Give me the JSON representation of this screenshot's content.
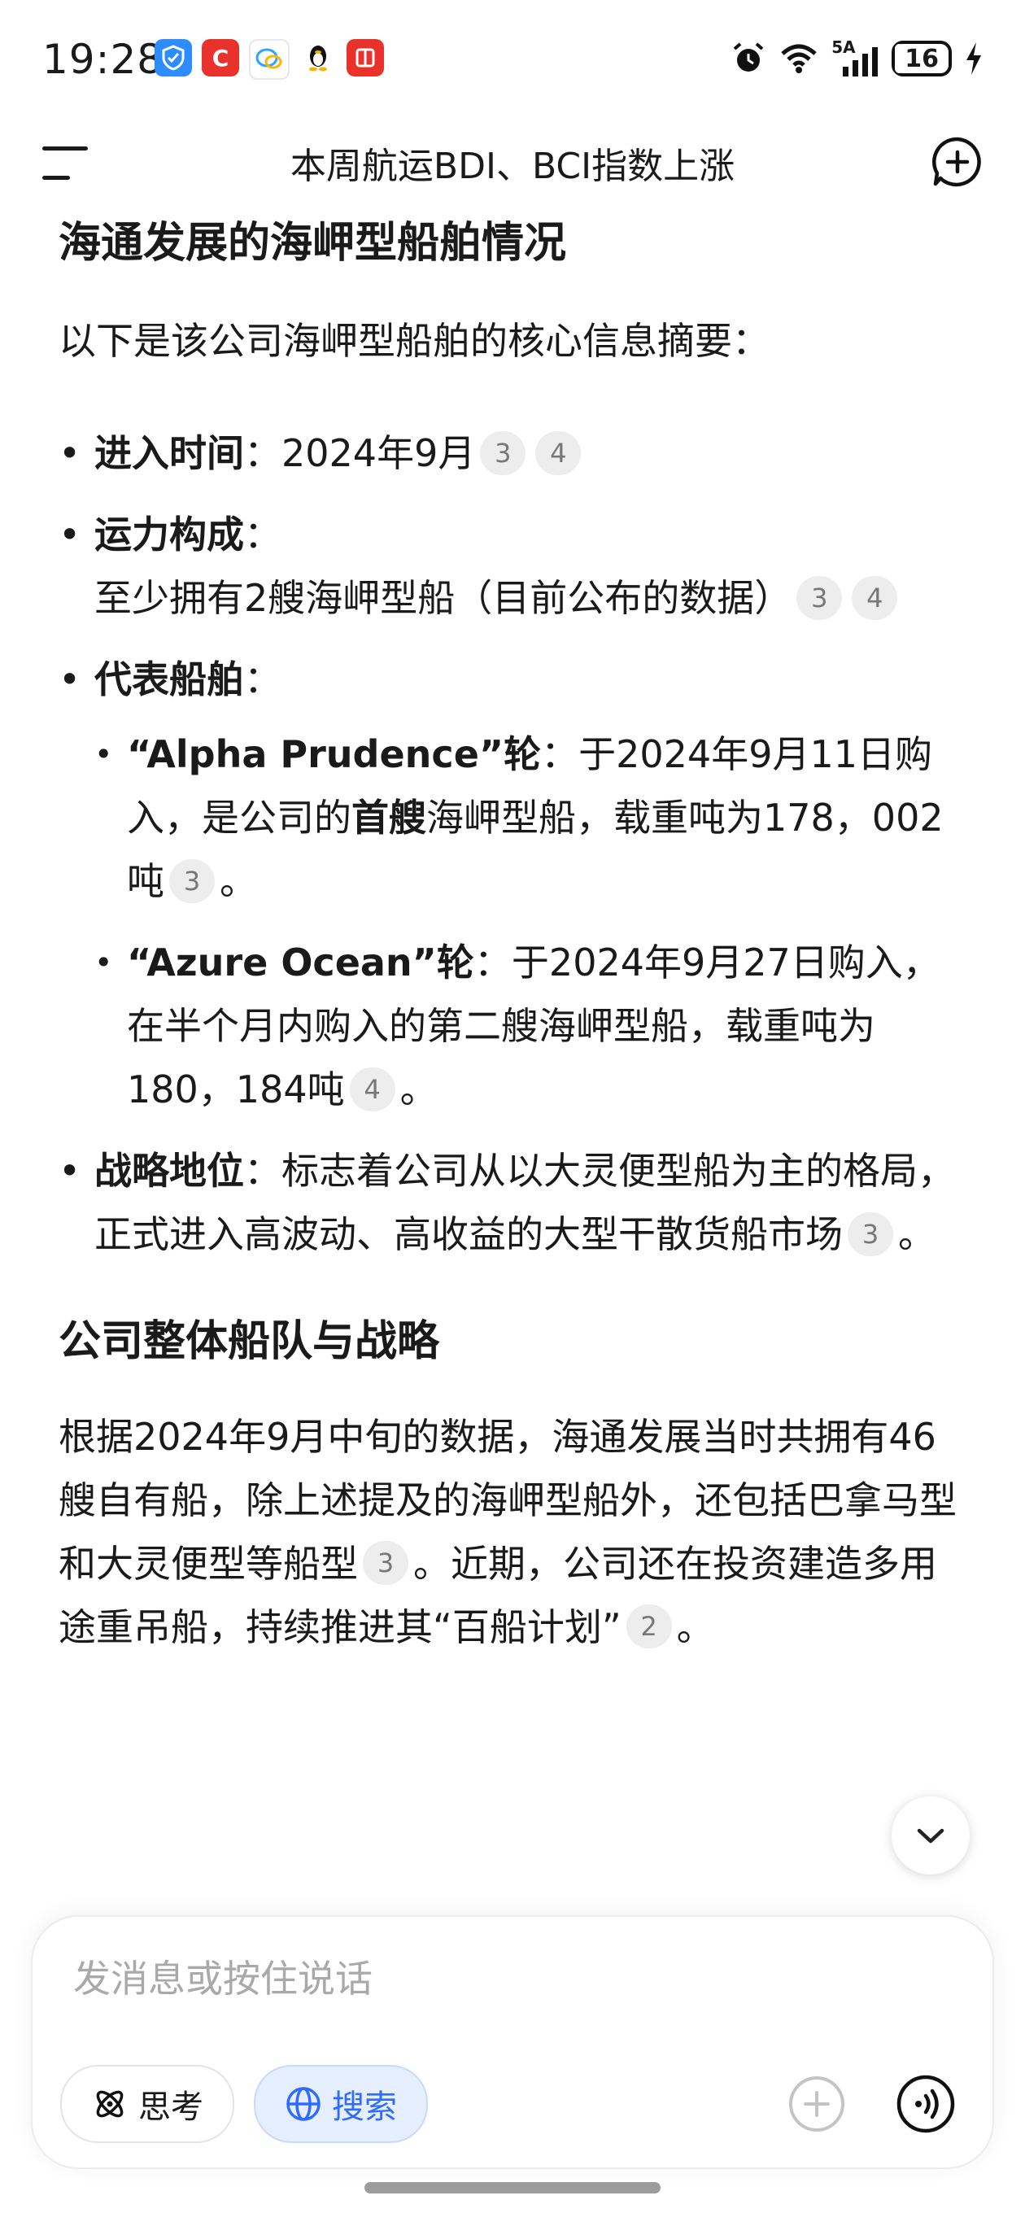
{
  "status_bar": {
    "time": "19:28",
    "notification_icons": [
      "shield-app-icon",
      "c-app-icon",
      "chat-bubble-icon",
      "penguin-icon",
      "red-app-icon"
    ],
    "system_icons": [
      "alarm-icon",
      "wifi-icon",
      "signal-5g-icon",
      "charging-icon"
    ],
    "network_label": "5A",
    "battery": "16",
    "battery_level": 0.16
  },
  "header": {
    "title": "本周航运BDI、BCI指数上涨"
  },
  "article": {
    "section1": {
      "heading": "海通发展的海岬型船舶情况",
      "intro": "以下是该公司海岬型船舶的核心信息摘要：",
      "items": [
        {
          "label": "进入时间",
          "sep": "：",
          "text": "2024年9月",
          "cites": [
            "3",
            "4"
          ]
        },
        {
          "label": "运力构成",
          "sep": "：",
          "text": "至少拥有2艘海岬型船（目前公布的数据）",
          "cites": [
            "3",
            "4"
          ]
        },
        {
          "label": "代表船舶",
          "sep": "："
        }
      ],
      "ships": [
        {
          "name": "“Alpha Prudence”轮",
          "sep": "：",
          "text1": "于2024年9月11日购入，是公司的",
          "emph": "首艘",
          "text2": "海岬型船，载重吨为178，002吨",
          "cite": "3",
          "end": "。"
        },
        {
          "name": "“Azure Ocean”轮",
          "sep": "：",
          "text1": "于2024年9月27日购入，在半个月内购入的第二艘海岬型船，载重吨为180，184吨",
          "cite": "4",
          "end": "。"
        }
      ],
      "strategy": {
        "label": "战略地位",
        "sep": "：",
        "text": "标志着公司从以大灵便型船为主的格局，正式进入高波动、高收益的大型干散货船市场",
        "cite": "3",
        "end": "。"
      }
    },
    "section2": {
      "heading": "公司整体船队与战略",
      "para_part1": "根据2024年9月中旬的数据，海通发展当时共拥有46艘自有船，除上述提及的海岬型船外，还包括巴拿马型和大灵便型等船型",
      "cite1": "3",
      "para_part2": "。近期，公司还在投资建造多用途重吊船，持续推进其“百船计划”",
      "cite2": "2",
      "para_end": "。"
    }
  },
  "input": {
    "placeholder": "发消息或按住说话",
    "think_label": "思考",
    "search_label": "搜索"
  },
  "colors": {
    "accent_blue": "#2f6bff",
    "search_chip_bg": "#e6efff",
    "citation_bg": "#ededed"
  }
}
